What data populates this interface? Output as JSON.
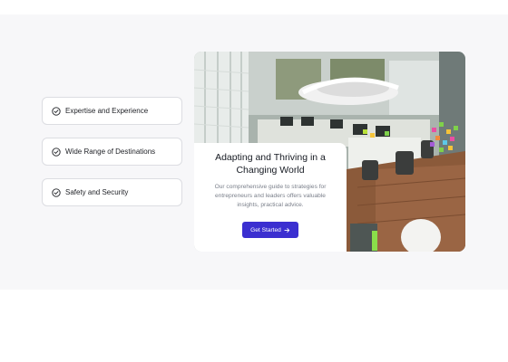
{
  "features": [
    {
      "label": "Expertise and Experience",
      "icon": "check-circle-icon"
    },
    {
      "label": "Wide Range of Destinations",
      "icon": "check-circle-icon"
    },
    {
      "label": "Safety and Security",
      "icon": "check-circle-icon"
    }
  ],
  "hero": {
    "image": "office-photo",
    "card": {
      "title": "Adapting and Thriving in a Changing World",
      "description": "Our comprehensive guide to strategies for entrepreneurs and leaders offers valuable insights, practical advice.",
      "button_label": "Get Started",
      "button_icon": "arrow-right-icon"
    }
  },
  "colors": {
    "accent": "#3b2fd0",
    "section_bg": "#f7f7f9",
    "border": "#dcdde2"
  }
}
